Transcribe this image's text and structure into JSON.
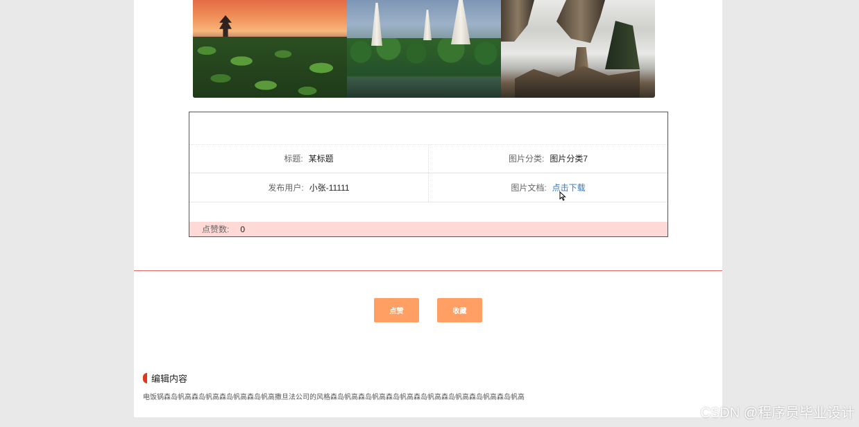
{
  "details": {
    "title_label": "标题:",
    "title_value": "某标题",
    "category_label": "图片分类:",
    "category_value": "图片分类7",
    "publisher_label": "发布用户:",
    "publisher_value": "小张-11111",
    "document_label": "图片文档:",
    "document_link": "点击下载",
    "likes_label": "点赞数:",
    "likes_value": "0"
  },
  "actions": {
    "like_label": "点赞",
    "favorite_label": "收藏"
  },
  "content": {
    "section_title": "编辑内容",
    "body": "电饭锅森岛帆高森岛帆高森岛帆高森岛帆高撒旦法公司的风格森岛帆高森岛帆高森岛帆高森岛帆高森岛帆高森岛帆高森岛帆高"
  },
  "watermark": "CSDN @程序员毕业设计",
  "colors": {
    "button": "#ff9f63",
    "divider": "#e06262",
    "likes_row": "#ffd9d6",
    "link": "#2f7bc8",
    "section_mark": "#e2371d"
  }
}
